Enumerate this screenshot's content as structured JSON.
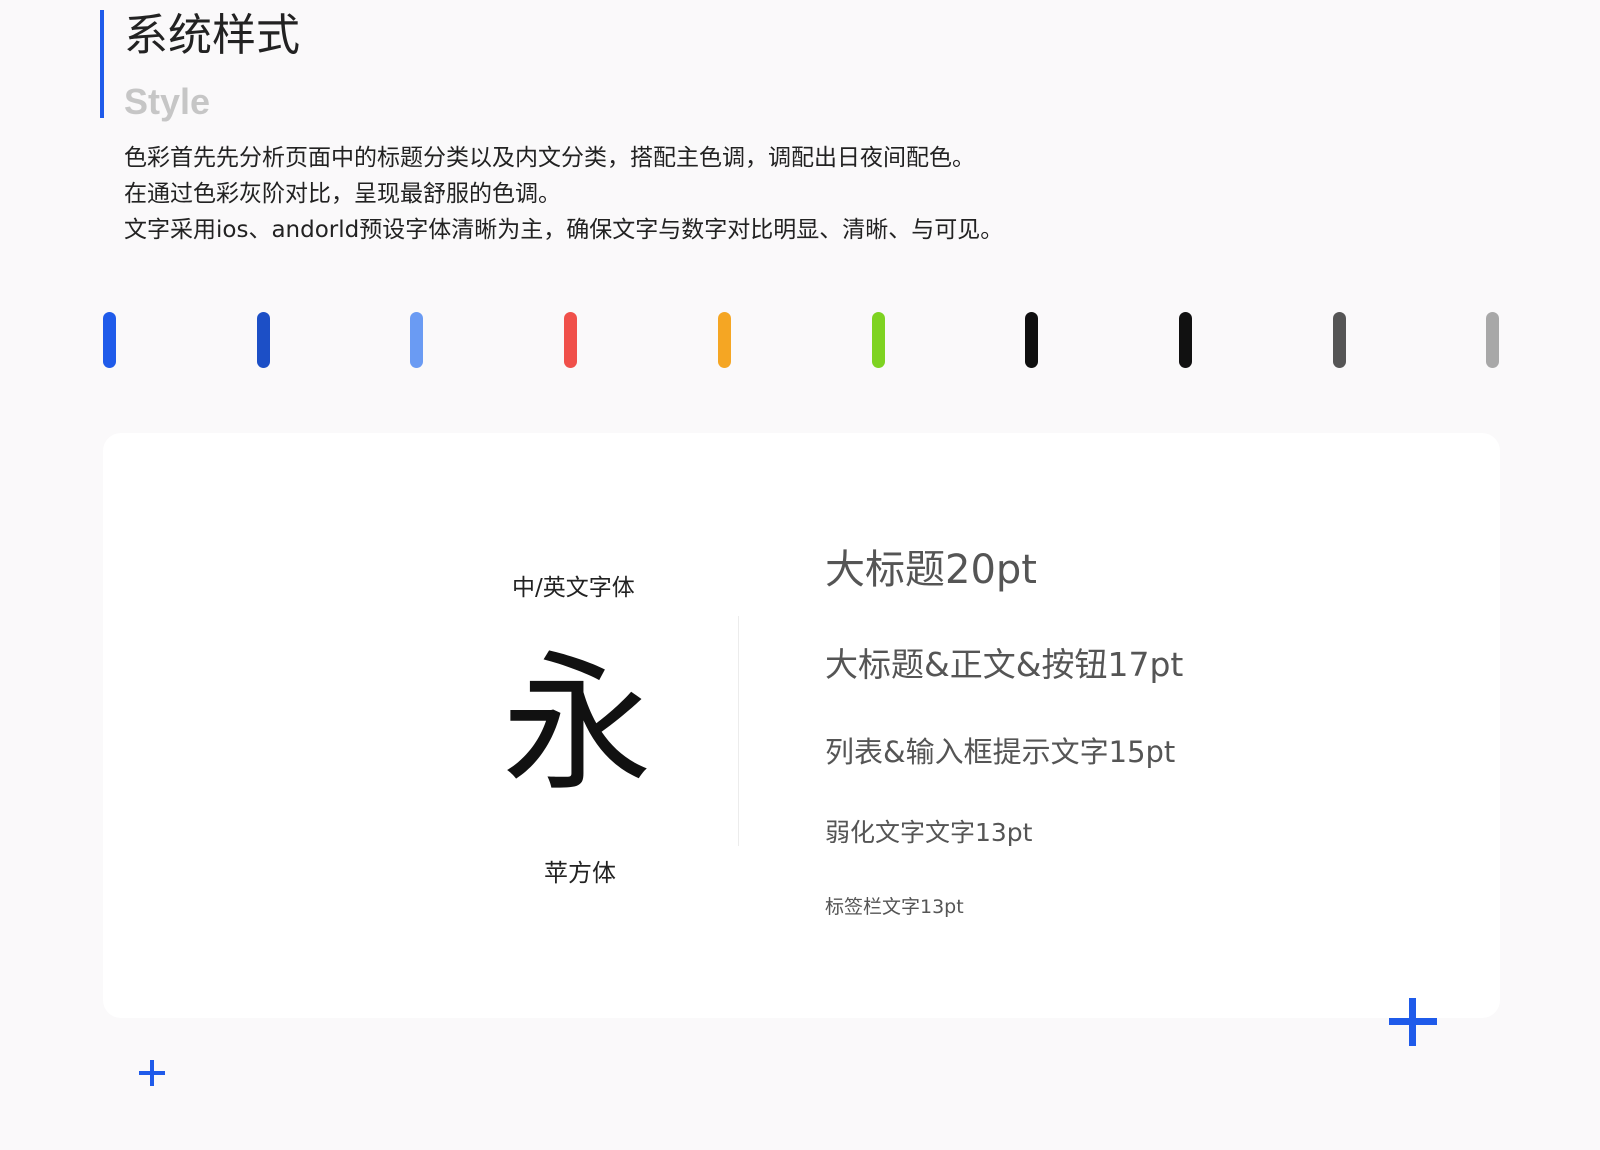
{
  "header": {
    "title": "系统样式",
    "subtitle": "Style",
    "accent_color": "#1f5bea"
  },
  "description": [
    "色彩首先先分析页面中的标题分类以及内文分类，搭配主色调，调配出日夜间配色。",
    "在通过色彩灰阶对比，呈现最舒服的色调。",
    "文字采用ios、andorld预设字体清晰为主，确保文字与数字对比明显、清晰、与可见。"
  ],
  "palette": [
    "#1f5bea",
    "#1c4fc6",
    "#6a9bf3",
    "#f0504a",
    "#f5a623",
    "#7ed321",
    "#0f0f0f",
    "#111111",
    "#555555",
    "#a8a8a8"
  ],
  "typography": {
    "caption": "中/英文字体",
    "sample_char": "永",
    "font_name": "苹方体",
    "specs": [
      "大标题20pt",
      "大标题&正文&按钮17pt",
      "列表&输入框提示文字15pt",
      "弱化文字文字13pt",
      "标签栏文字13pt"
    ]
  },
  "icons": {
    "add_large": "plus-icon",
    "add_small": "plus-icon"
  }
}
